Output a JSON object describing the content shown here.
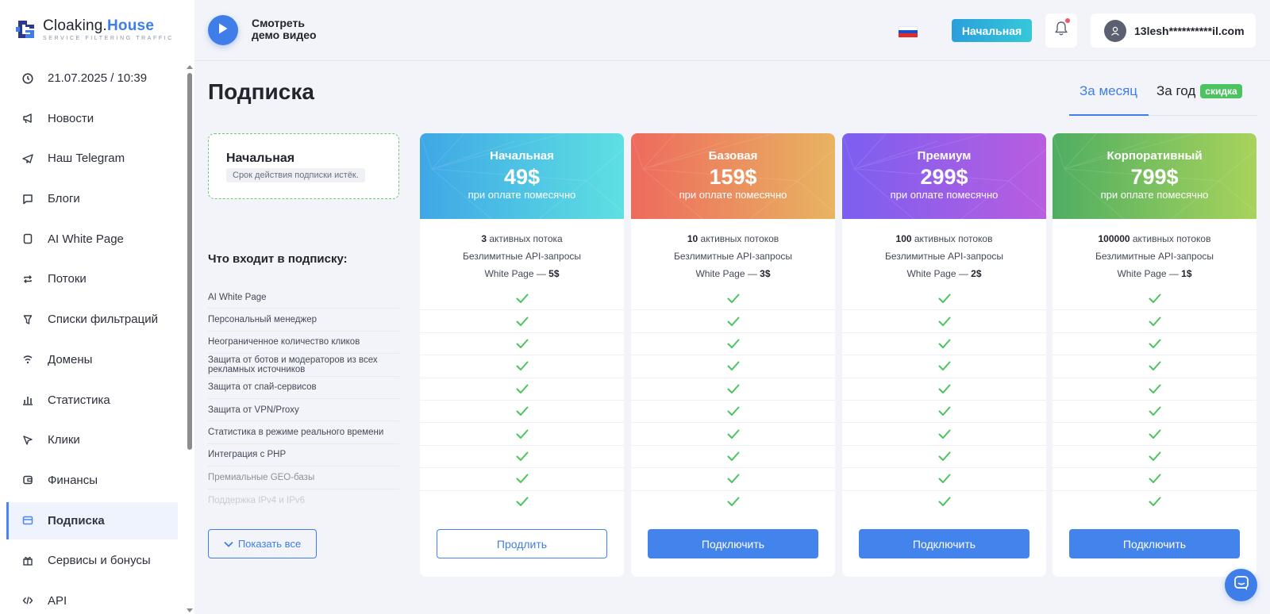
{
  "brand": {
    "name_part1": "Cloaking.",
    "name_part2": "House",
    "tagline": "SERVICE FILTERING TRAFFIC"
  },
  "sidebar": {
    "items": [
      {
        "icon": "clock-icon",
        "label": "21.07.2025 / 10:39"
      },
      {
        "icon": "megaphone-icon",
        "label": "Новости"
      },
      {
        "icon": "telegram-icon",
        "label": "Наш Telegram"
      },
      {
        "icon": "chat-bubble-icon",
        "label": "Блоги"
      },
      {
        "icon": "page-icon",
        "label": "AI White Page"
      },
      {
        "icon": "repeat-icon",
        "label": "Потоки"
      },
      {
        "icon": "filter-icon",
        "label": "Списки фильтраций"
      },
      {
        "icon": "wifi-icon",
        "label": "Домены"
      },
      {
        "icon": "bar-chart-icon",
        "label": "Статистика"
      },
      {
        "icon": "cursor-icon",
        "label": "Клики"
      },
      {
        "icon": "wallet-icon",
        "label": "Финансы"
      },
      {
        "icon": "card-icon",
        "label": "Подписка",
        "active": true
      },
      {
        "icon": "gift-icon",
        "label": "Сервисы и бонусы"
      },
      {
        "icon": "code-icon",
        "label": "API"
      }
    ]
  },
  "header": {
    "demo_line1": "Смотреть",
    "demo_line2": "демо видео",
    "language": "ru",
    "plan_pill": "Начальная",
    "user_email": "13lesh**********il.com"
  },
  "page": {
    "title": "Подписка",
    "tab_month": "За месяц",
    "tab_year": "За год",
    "discount_badge": "скидка"
  },
  "current": {
    "name": "Начальная",
    "note": "Срок действия подписки истёк."
  },
  "features_title": "Что входит в подписку:",
  "features": [
    "AI White Page",
    "Персональный менеджер",
    "Неограниченное количество кликов",
    "Защита от ботов и модераторов из всех рекламных источников",
    "Защита от спай-сервисов",
    "Защита от VPN/Proxy",
    "Статистика в режиме реального времени",
    "Интеграция с PHP",
    "Премиальные GEO-базы",
    "Поддержка IPv4 и IPv6"
  ],
  "show_all": "Показать все",
  "plans": [
    {
      "name": "Начальная",
      "price": "49$",
      "period": "при оплате помесячно",
      "streams_count": "3",
      "streams_label": " активных потока",
      "api": "Безлимитные API-запросы",
      "wp_label": "White Page — ",
      "wp_price": "5$",
      "button": "Продлить",
      "colors": [
        "#3ea7e6",
        "#5ee0e2"
      ]
    },
    {
      "name": "Базовая",
      "price": "159$",
      "period": "при оплате помесячно",
      "streams_count": "10",
      "streams_label": " активных потоков",
      "api": "Безлимитные API-запросы",
      "wp_label": "White Page — ",
      "wp_price": "3$",
      "button": "Подключить",
      "colors": [
        "#ee6a5d",
        "#e8b461"
      ]
    },
    {
      "name": "Премиум",
      "price": "299$",
      "period": "при оплате помесячно",
      "streams_count": "100",
      "streams_label": " активных потоков",
      "api": "Безлимитные API-запросы",
      "wp_label": "White Page — ",
      "wp_price": "2$",
      "button": "Подключить",
      "colors": [
        "#7b5ff0",
        "#b85de0"
      ]
    },
    {
      "name": "Корпоративный",
      "price": "799$",
      "period": "при оплате помесячно",
      "streams_count": "100000",
      "streams_label": " активных потоков",
      "api": "Безлимитные API-запросы",
      "wp_label": "White Page — ",
      "wp_price": "1$",
      "button": "Подключить",
      "colors": [
        "#4fae62",
        "#a8d35c"
      ]
    }
  ],
  "colors": {
    "accent": "#3f7ee8",
    "check": "#4cc35e",
    "notification": "#f05a6a"
  }
}
